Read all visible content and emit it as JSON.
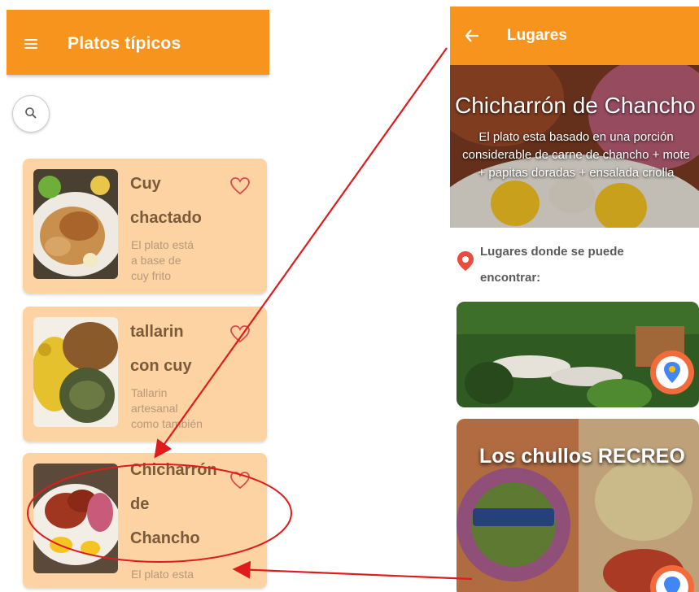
{
  "left_screen": {
    "title": "Platos típicos",
    "menu_icon": "hamburger-icon",
    "search_icon": "search-icon",
    "dishes": [
      {
        "name_line1": "Cuy",
        "name_line2": "chactado",
        "name_line3": "",
        "desc_line1": "El plato está",
        "desc_line2": "a base de",
        "desc_line3": "cuy frito"
      },
      {
        "name_line1": "tallarin",
        "name_line2": "con cuy",
        "name_line3": "",
        "desc_line1": "Tallarin",
        "desc_line2": "artesanal",
        "desc_line3": "como también"
      },
      {
        "name_line1": "Chicharrón",
        "name_line2": "de",
        "name_line3": "Chancho",
        "desc_line1": "El plato esta",
        "desc_line2": "",
        "desc_line3": ""
      }
    ]
  },
  "right_screen": {
    "title": "Lugares",
    "back_icon": "arrow-left-icon",
    "hero_title": "Chicharrón de Chancho",
    "hero_desc": "El plato esta basado en una porción considerable de carne de chancho + mote + papitas doradas + ensalada criolla",
    "places_label_line1": "Lugares donde se puede",
    "places_label_line2": "encontrar:",
    "places": [
      {
        "name": ""
      },
      {
        "name": "Los chullos RECREO"
      }
    ]
  },
  "colors": {
    "primary": "#f7941d",
    "card_bg": "#fdd3a3",
    "annotation": "#e01b1b"
  }
}
